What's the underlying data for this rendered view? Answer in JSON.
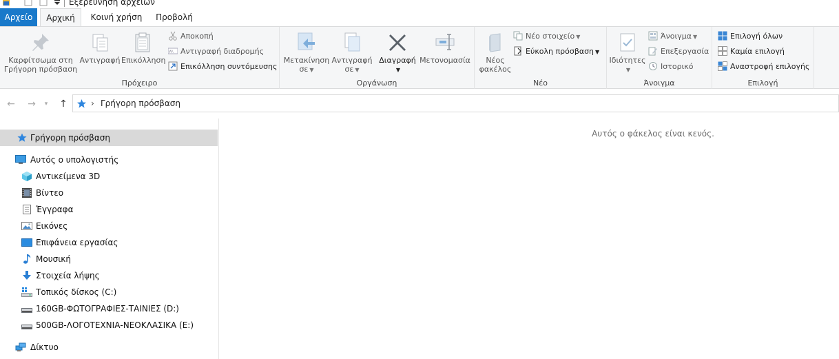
{
  "window": {
    "title": "Εξερεύνηση αρχείων"
  },
  "tabs": {
    "file": "Αρχείο",
    "home": "Αρχική",
    "share": "Κοινή χρήση",
    "view": "Προβολή"
  },
  "ribbon": {
    "clipboard": {
      "label": "Πρόχειρο",
      "pin_line1": "Καρφίτσωμα στη",
      "pin_line2": "Γρήγορη πρόσβαση",
      "copy": "Αντιγραφή",
      "paste": "Επικόλληση",
      "cut": "Αποκοπή",
      "copy_path": "Αντιγραφή διαδρομής",
      "paste_shortcut": "Επικόλληση συντόμευσης"
    },
    "organize": {
      "label": "Οργάνωση",
      "move_line1": "Μετακίνηση",
      "move_line2": "σε",
      "copy_line1": "Αντιγραφή",
      "copy_line2": "σε",
      "delete": "Διαγραφή",
      "rename": "Μετονομασία"
    },
    "new": {
      "label": "Νέο",
      "folder_line1": "Νέος",
      "folder_line2": "φακέλος",
      "new_item": "Νέο στοιχείο",
      "easy_access": "Εύκολη πρόσβαση"
    },
    "open": {
      "label": "Άνοιγμα",
      "properties": "Ιδιότητες",
      "open": "Άνοιγμα",
      "edit": "Επεξεργασία",
      "history": "Ιστορικό"
    },
    "select": {
      "label": "Επιλογή",
      "select_all": "Επιλογή όλων",
      "select_none": "Καμία επιλογή",
      "invert": "Αναστροφή επιλογής"
    }
  },
  "address": {
    "crumb": "Γρήγορη πρόσβαση"
  },
  "nav": {
    "quick_access": "Γρήγορη πρόσβαση",
    "this_pc": "Αυτός ο υπολογιστής",
    "objects3d": "Αντικείμενα 3D",
    "videos": "Βίντεο",
    "documents": "Έγγραφα",
    "pictures": "Εικόνες",
    "desktop": "Επιφάνεια εργασίας",
    "music": "Μουσική",
    "downloads": "Στοιχεία λήψης",
    "drive_c": "Τοπικός δίσκος (C:)",
    "drive_d": "160GB-ΦΩΤΟΓΡΑΦΙΕΣ-ΤΑΙΝΙΕΣ  (D:)",
    "drive_e": "500GB-ΛΟΓΟΤΕΧΝΙΑ-ΝΕΟΚΛΑΣΙΚΑ (E:)",
    "network": "Δίκτυο"
  },
  "content": {
    "empty_message": "Αυτός ο φάκελος είναι κενός."
  },
  "colors": {
    "accent": "#1979ca",
    "selection": "#d9d9d9",
    "ribbon_bg": "#f5f6f7"
  }
}
